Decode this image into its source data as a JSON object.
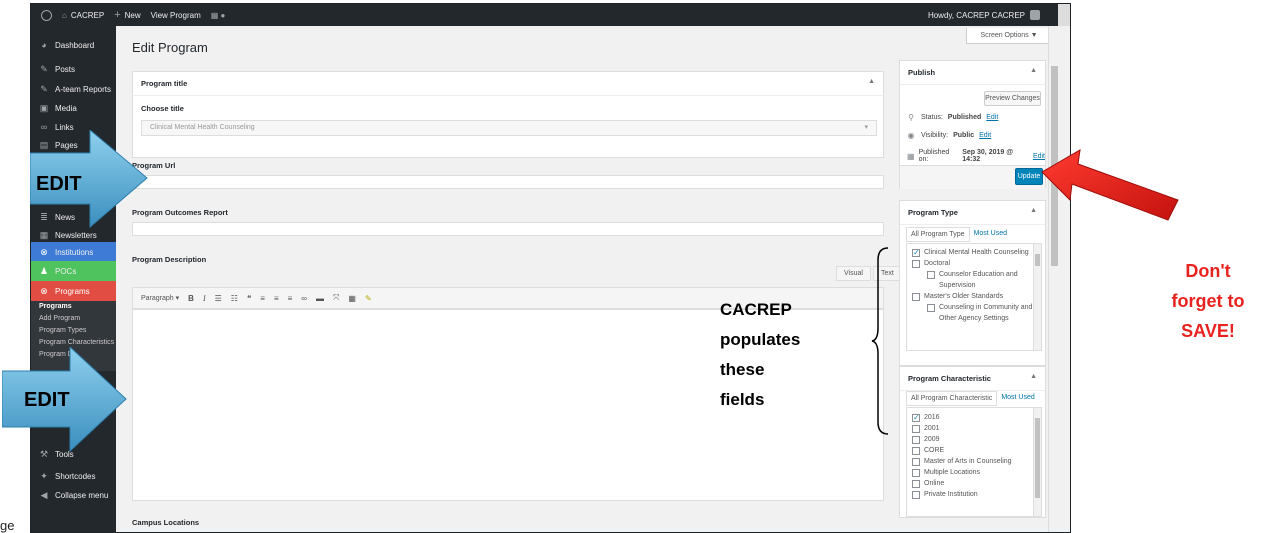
{
  "adminbar": {
    "site_name": "CACREP",
    "new_label": "New",
    "view_label": "View Program",
    "howdy": "Howdy, CACREP CACREP"
  },
  "sidebar": {
    "items": [
      {
        "label": "Dashboard",
        "icon": "dashboard-icon"
      },
      {
        "label": "Posts",
        "icon": "pin-icon"
      },
      {
        "label": "A-team Reports",
        "icon": "pin-icon"
      },
      {
        "label": "Media",
        "icon": "media-icon"
      },
      {
        "label": "Links",
        "icon": "link-icon"
      },
      {
        "label": "Pages",
        "icon": "pages-icon"
      },
      {
        "label": "News",
        "icon": "news-icon"
      },
      {
        "label": "Newsletters",
        "icon": "newsletter-icon"
      },
      {
        "label": "Institutions",
        "icon": "institution-icon"
      },
      {
        "label": "POCs",
        "icon": "person-icon"
      },
      {
        "label": "Programs",
        "icon": "programs-icon"
      },
      {
        "label": "Tools",
        "icon": "wrench-icon"
      },
      {
        "label": "Shortcodes",
        "icon": "shortcode-icon"
      },
      {
        "label": "Collapse menu",
        "icon": "collapse-icon"
      }
    ],
    "submenu": [
      "Programs",
      "Add Program",
      "Program Types",
      "Program Characteristics",
      "Program De"
    ]
  },
  "main": {
    "page_title": "Edit Program",
    "screen_options": "Screen Options ▼",
    "program_title_box": "Program title",
    "choose_title_label": "Choose title",
    "choose_title_value": "Clinical Mental Health Counseling",
    "program_url_label": "Program Url",
    "outcomes_label": "Program Outcomes Report",
    "description_label": "Program Description",
    "visual_tab": "Visual",
    "text_tab": "Text",
    "paragraph_select": "Paragraph",
    "campus_label": "Campus Locations"
  },
  "publish": {
    "title": "Publish",
    "preview": "Preview Changes",
    "status_label": "Status:",
    "status_value": "Published",
    "visibility_label": "Visibility:",
    "visibility_value": "Public",
    "published_on_label": "Published on:",
    "published_on_value": "Sep 30, 2019 @ 14:32",
    "edit": "Edit",
    "update": "Update"
  },
  "program_type": {
    "title": "Program Type",
    "tab_all": "All Program Type",
    "tab_most": "Most Used",
    "items": [
      {
        "label": "Clinical Mental Health Counseling",
        "checked": true,
        "indent": false
      },
      {
        "label": "Doctoral",
        "checked": false,
        "indent": false
      },
      {
        "label": "Counselor Education and Supervision",
        "checked": false,
        "indent": true
      },
      {
        "label": "Master's Older Standards",
        "checked": false,
        "indent": false
      },
      {
        "label": "Counseling in Community and Other Agency Settings",
        "checked": false,
        "indent": true
      }
    ]
  },
  "program_characteristic": {
    "title": "Program Characteristic",
    "tab_all": "All Program Characteristic",
    "tab_most": "Most Used",
    "items": [
      {
        "label": "2016",
        "checked": true
      },
      {
        "label": "2001",
        "checked": false
      },
      {
        "label": "2009",
        "checked": false
      },
      {
        "label": "CORE",
        "checked": false
      },
      {
        "label": "Master of Arts in Counseling",
        "checked": false
      },
      {
        "label": "Multiple Locations",
        "checked": false
      },
      {
        "label": "Online",
        "checked": false
      },
      {
        "label": "Private Institution",
        "checked": false
      }
    ]
  },
  "annotations": {
    "edit_1": "EDIT",
    "edit_2": "EDIT",
    "cacrep_lines": [
      "CACREP",
      "populates",
      "these",
      "fields"
    ],
    "reminder_lines": [
      "Don't",
      "forget to",
      "SAVE!"
    ],
    "bottom_crop": "ge",
    "arrow_color": "#5fb0d8",
    "reminder_color": "#e8231f"
  }
}
